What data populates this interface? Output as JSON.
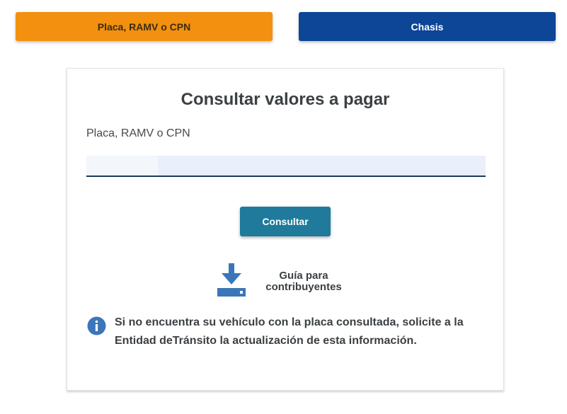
{
  "tabs": {
    "placa_label": "Placa, RAMV o CPN",
    "chasis_label": "Chasis"
  },
  "form": {
    "title": "Consultar valores a pagar",
    "field_label": "Placa, RAMV o CPN",
    "field_value": "",
    "submit_label": "Consultar"
  },
  "guide": {
    "line1": "Guía para",
    "line2": "contribuyentes",
    "icon": "download-icon"
  },
  "info": {
    "icon": "info-icon",
    "message": "Si no encuentra su vehículo con la placa consultada, solicite a la Entidad deTránsito la actualización de esta información."
  },
  "colors": {
    "placa_tab": "#f3900f",
    "chasis_tab": "#0d4597",
    "submit_button": "#1f7a9b",
    "icon_blue": "#3b76b9"
  }
}
